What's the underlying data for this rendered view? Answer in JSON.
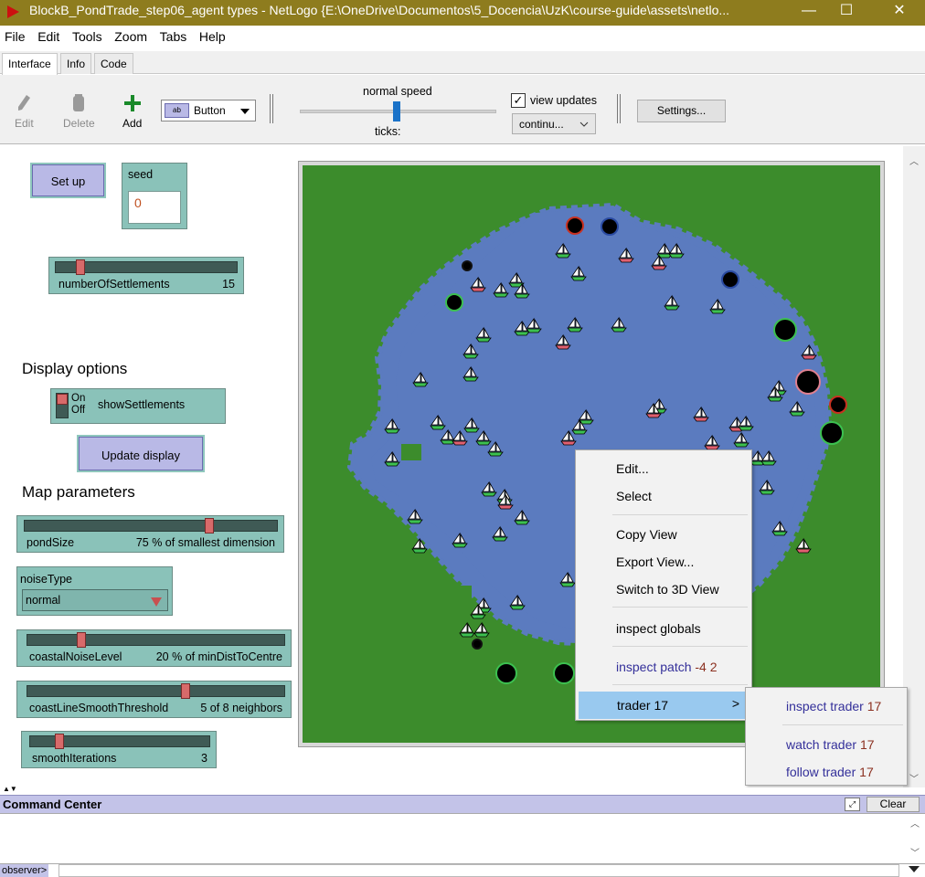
{
  "window": {
    "title": "BlockB_PondTrade_step06_agent types - NetLogo {E:\\OneDrive\\Documentos\\5_Docencia\\UzK\\course-guide\\assets\\netlo...",
    "minimize": "—",
    "maximize": "☐",
    "close": "✕"
  },
  "menu": [
    "File",
    "Edit",
    "Tools",
    "Zoom",
    "Tabs",
    "Help"
  ],
  "tabs": [
    "Interface",
    "Info",
    "Code"
  ],
  "toolbar": {
    "edit": "Edit",
    "delete": "Delete",
    "add": "Add",
    "widget_type": "Button",
    "speed_label": "normal speed",
    "ticks_label": "ticks:",
    "view_updates": "view updates",
    "update_mode": "continu...",
    "settings": "Settings..."
  },
  "widgets": {
    "setup": "Set up",
    "seed_label": "seed",
    "seed_value": "0",
    "num_settlements": {
      "label": "numberOfSettlements",
      "value": "15",
      "fraction": 0.12
    },
    "display_options": "Display options",
    "show_settlements": {
      "on": "On",
      "off": "Off",
      "label": "showSettlements"
    },
    "update_display": "Update display",
    "map_parameters": "Map parameters",
    "pond_size": {
      "label": "pondSize",
      "value": "75 % of smallest dimension",
      "fraction": 0.74
    },
    "noise_type": {
      "label": "noiseType",
      "value": "normal"
    },
    "coastal_noise": {
      "label": "coastalNoiseLevel",
      "value": "20 % of minDistToCentre",
      "fraction": 0.2
    },
    "smooth_threshold": {
      "label": "coastLineSmoothThreshold",
      "value": "5 of 8 neighbors",
      "fraction": 0.62
    },
    "smooth_iterations": {
      "label": "smoothIterations",
      "value": "3",
      "fraction": 0.15
    }
  },
  "context_menu": {
    "edit": "Edit...",
    "select": "Select",
    "copy_view": "Copy View",
    "export_view": "Export View...",
    "switch_3d": "Switch to 3D View",
    "inspect_globals": "inspect globals",
    "inspect_patch": "inspect patch",
    "patch_coords": "-4 2",
    "trader": "trader 17",
    "arrow": ">"
  },
  "submenu": {
    "inspect": "inspect",
    "watch": "watch",
    "follow": "follow",
    "agent": "trader",
    "agent_id": "17"
  },
  "command_center": {
    "title": "Command Center",
    "clear": "Clear",
    "observer": "observer>"
  },
  "colors": {
    "land": "#3c8c2c",
    "water": "#5b7bbf",
    "button": "#b9b9e6",
    "widget": "#8ac2b9",
    "title_bar": "#8e7c1e",
    "highlight": "#99c9ef"
  }
}
